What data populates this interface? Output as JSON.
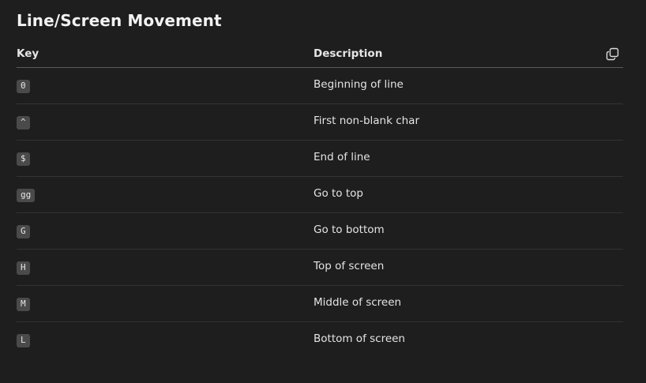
{
  "title": "Line/Screen Movement",
  "table": {
    "headers": {
      "key": "Key",
      "description": "Description"
    },
    "copy_icon": "copy-icon",
    "rows": [
      {
        "key": "0",
        "description": "Beginning of line"
      },
      {
        "key": "^",
        "description": "First non-blank char"
      },
      {
        "key": "$",
        "description": "End of line"
      },
      {
        "key": "gg",
        "description": "Go to top"
      },
      {
        "key": "G",
        "description": "Go to bottom"
      },
      {
        "key": "H",
        "description": "Top of screen"
      },
      {
        "key": "M",
        "description": "Middle of screen"
      },
      {
        "key": "L",
        "description": "Bottom of screen"
      }
    ]
  },
  "colors": {
    "background": "#1e1e1e",
    "kbd_background": "#4a4a4a",
    "header_border": "#5a5a5a",
    "row_border": "#333333"
  }
}
